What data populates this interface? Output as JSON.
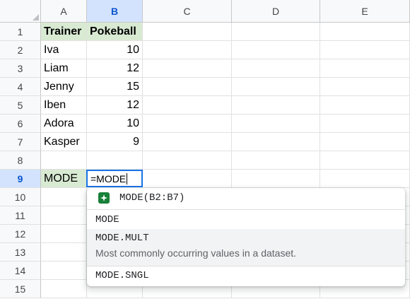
{
  "columns": [
    "A",
    "B",
    "C",
    "D",
    "E"
  ],
  "rows": [
    "1",
    "2",
    "3",
    "4",
    "5",
    "6",
    "7",
    "8",
    "9",
    "10",
    "11",
    "12",
    "13",
    "14",
    "15"
  ],
  "cells": {
    "a1": "Trainer",
    "b1": "Pokeball",
    "a2": "Iva",
    "b2": "10",
    "a3": "Liam",
    "b3": "12",
    "a4": "Jenny",
    "b4": "15",
    "a5": "Iben",
    "b5": "12",
    "a6": "Adora",
    "b6": "10",
    "a7": "Kasper",
    "b7": "9",
    "a9": "MODE"
  },
  "editor": {
    "value": "=MODE"
  },
  "autocomplete": {
    "suggestion": "MODE(B2:B7)",
    "items": [
      "MODE",
      "MODE.MULT",
      "MODE.SNGL"
    ],
    "highlight_desc": "Most commonly occurring values in a dataset."
  },
  "colors": {
    "header_green": "#d9ead3",
    "selection_blue": "#1a73e8",
    "spark_green": "#188038"
  }
}
